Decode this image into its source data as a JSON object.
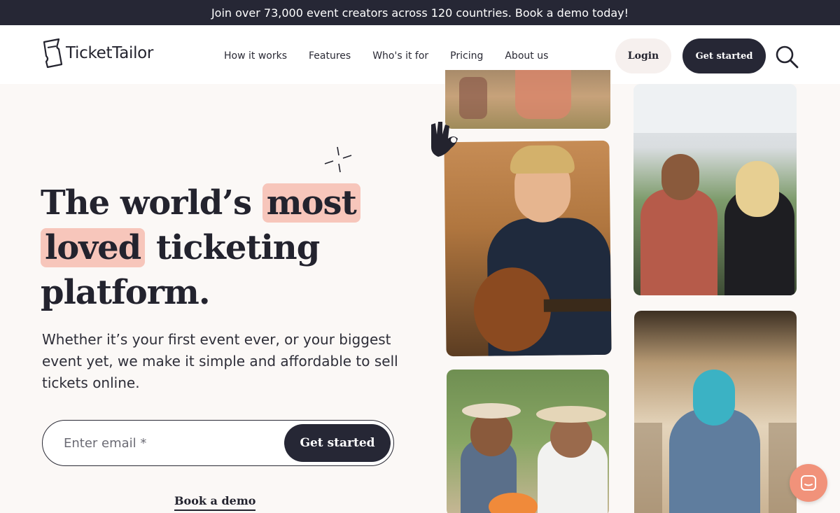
{
  "announcement": "Join over 73,000 event creators across 120 countries. Book a demo today!",
  "brand": {
    "name": "TicketTailor",
    "icon": "ticket-logo-icon"
  },
  "nav": {
    "items": [
      {
        "label": "How it works"
      },
      {
        "label": "Features"
      },
      {
        "label": "Who's it for"
      },
      {
        "label": "Pricing"
      },
      {
        "label": "About us"
      }
    ],
    "login_label": "Login",
    "get_started_label": "Get started",
    "search_icon": "search-icon"
  },
  "hero": {
    "headline_part1": "The world’s ",
    "headline_highlight1": "most",
    "headline_highlight2": "loved",
    "headline_part2": " ticketing",
    "headline_part3": "platform.",
    "subtext": "Whether it’s your first event ever, or your biggest event yet, we make it simple and affordable to sell tickets online.",
    "email_placeholder": "Enter email *",
    "email_submit_label": "Get started",
    "book_demo_label": "Book a demo"
  },
  "colors": {
    "dark": "#262735",
    "highlight": "#f7c6bb",
    "chat": "#f1927a",
    "background": "#fbf8f6"
  },
  "chat": {
    "icon": "chat-icon"
  }
}
